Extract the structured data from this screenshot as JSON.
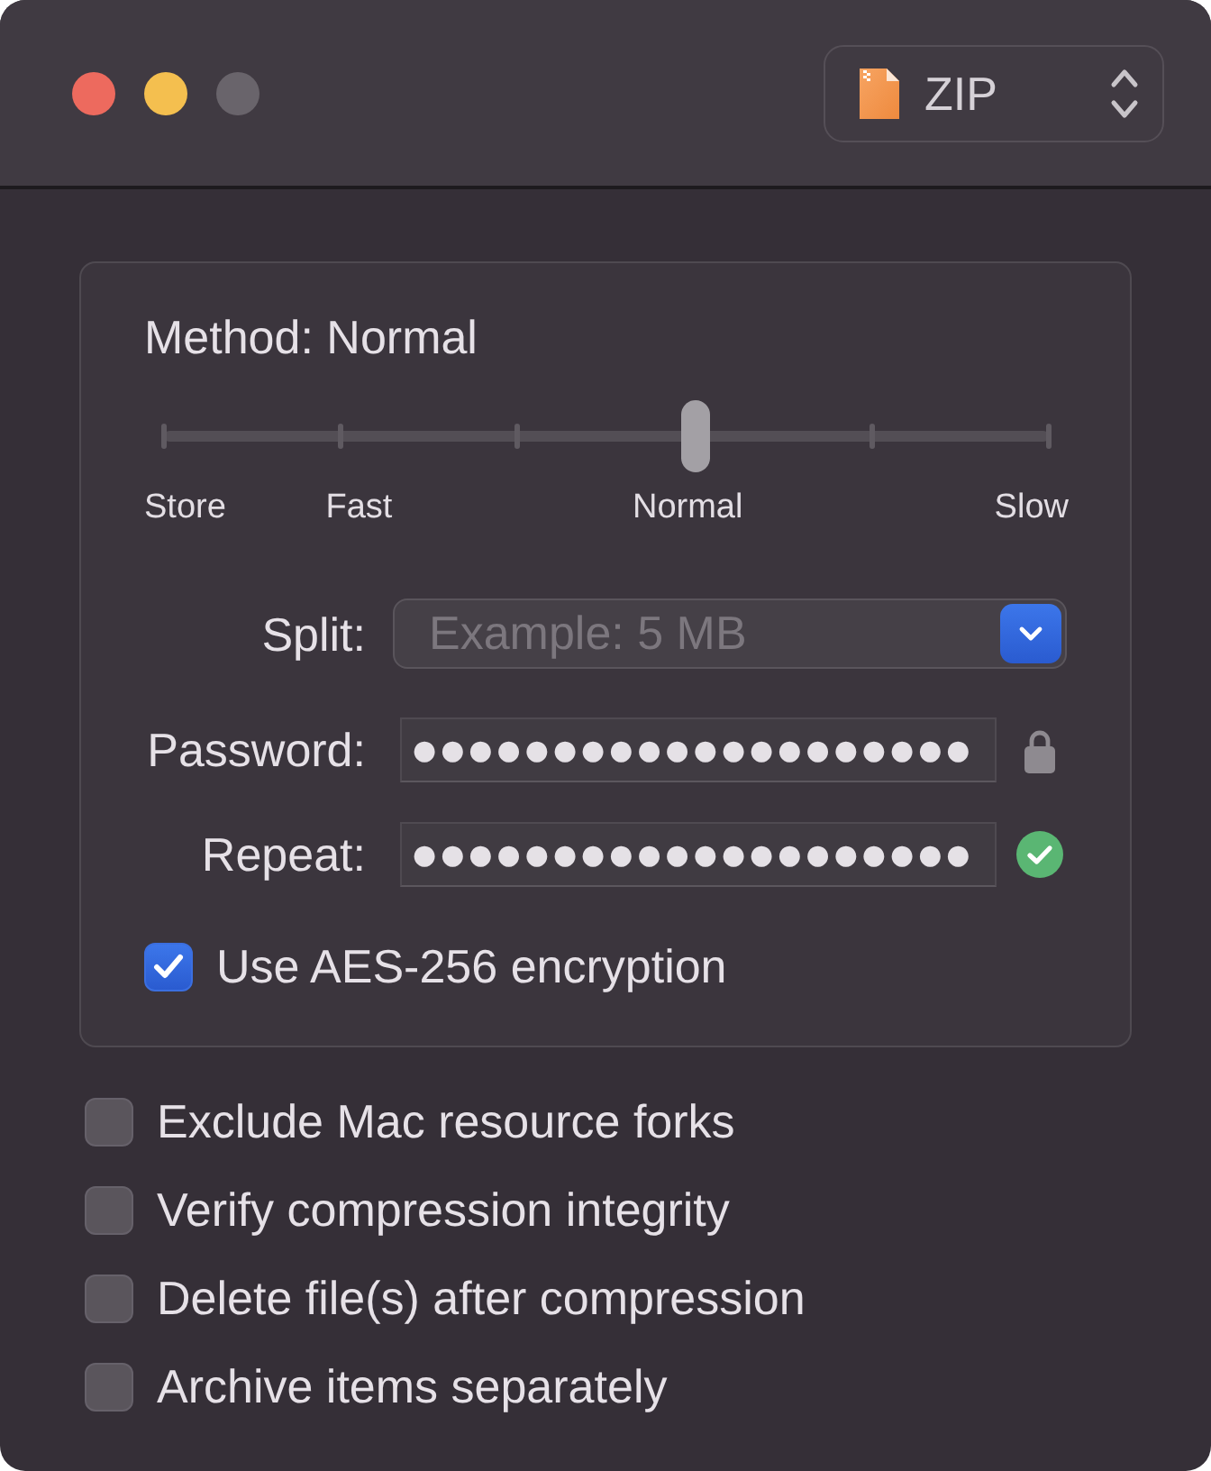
{
  "window": {
    "controls": [
      {
        "kind": "close",
        "disabled": false
      },
      {
        "kind": "minimize",
        "disabled": false
      },
      {
        "kind": "zoom",
        "disabled": true
      }
    ]
  },
  "format_popup": {
    "value": "ZIP"
  },
  "method": {
    "label": "Method: Normal",
    "slider": {
      "level": 0.6,
      "labels": [
        "Store",
        "Fast",
        "Normal",
        "Slow"
      ]
    }
  },
  "split": {
    "label": "Split:",
    "placeholder": "Example: 5 MB"
  },
  "password": {
    "label": "Password:",
    "value": "●●●●●●●●●●●●●●●●●●●●"
  },
  "repeat": {
    "label": "Repeat:",
    "value": "●●●●●●●●●●●●●●●●●●●●",
    "matches": true
  },
  "encryption": {
    "label": "Use AES-256 encryption",
    "checked": true
  },
  "options": [
    {
      "label": "Exclude Mac resource forks",
      "checked": false
    },
    {
      "label": "Verify compression integrity",
      "checked": false
    },
    {
      "label": "Delete file(s) after compression",
      "checked": false
    },
    {
      "label": "Archive items separately",
      "checked": false
    }
  ]
}
